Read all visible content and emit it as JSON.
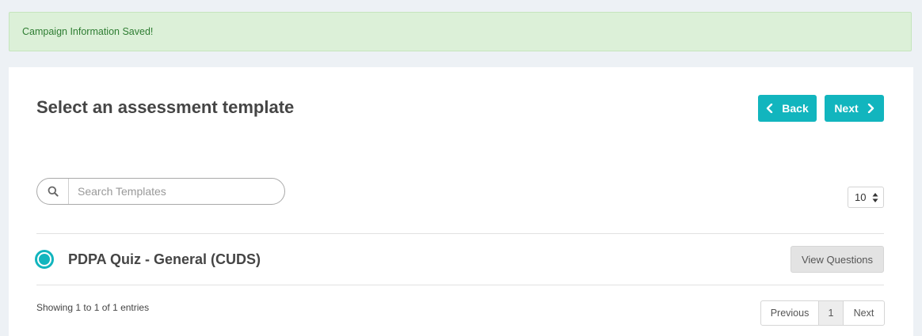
{
  "alert": {
    "message": "Campaign Information Saved!"
  },
  "header": {
    "title": "Select an assessment template"
  },
  "toolbar": {
    "back_label": "Back",
    "next_label": "Next"
  },
  "search": {
    "placeholder": "Search Templates",
    "value": "",
    "icon": "search-icon"
  },
  "page_size": {
    "selected": "10"
  },
  "templates": [
    {
      "title": "PDPA Quiz - General (CUDS)",
      "selected": true,
      "action_label": "View Questions"
    }
  ],
  "footer": {
    "showing_text": "Showing 1 to 1 of 1 entries",
    "pagination": {
      "previous": "Previous",
      "current": "1",
      "next": "Next"
    }
  },
  "colors": {
    "accent": "#12b5be",
    "success_bg": "#dcf0d8",
    "success_text": "#2e7d32"
  }
}
